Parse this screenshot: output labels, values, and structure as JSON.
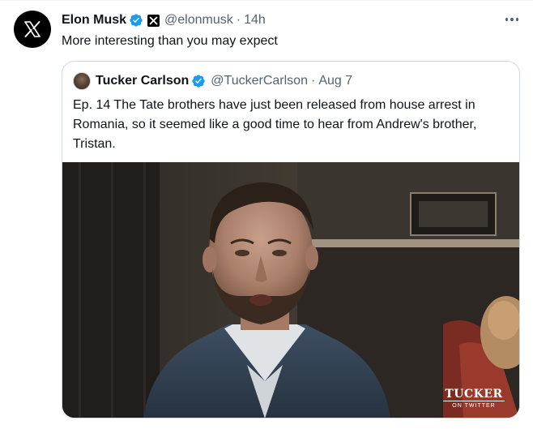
{
  "tweet": {
    "author_name": "Elon Musk",
    "author_handle": "@elonmusk",
    "separator": "·",
    "timestamp": "14h",
    "text": "More interesting than you may expect"
  },
  "quoted_tweet": {
    "author_name": "Tucker Carlson",
    "author_handle": "@TuckerCarlson",
    "separator": "·",
    "timestamp": "Aug 7",
    "text": "Ep. 14  The Tate brothers have just been released from house arrest in Romania, so it seemed like a good time to hear from Andrew's brother, Tristan.",
    "media_watermark": {
      "main": "TUCKER",
      "sub": "ON TWITTER"
    }
  },
  "colors": {
    "verified_badge": "#1d9bf0",
    "secondary_text": "#536471",
    "border": "#cfd9de"
  },
  "icons": {
    "avatar": "x-logo-icon",
    "verified": "verified-badge-icon",
    "affiliation": "x-affiliation-badge-icon",
    "more": "more-options-icon"
  }
}
